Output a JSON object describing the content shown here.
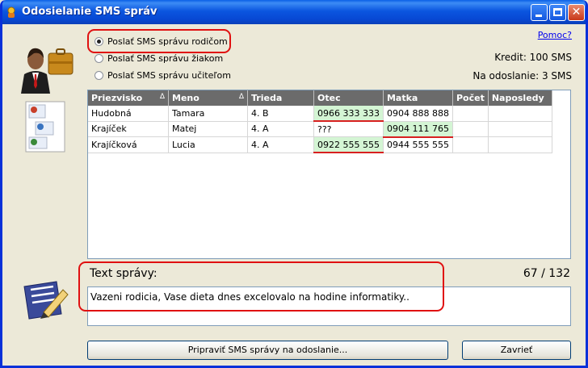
{
  "window": {
    "title": "Odosielanie SMS správ"
  },
  "options": {
    "parents": "Poslať SMS správu rodičom",
    "students": "Poslať SMS správu žiakom",
    "teachers": "Poslať SMS správu učiteľom",
    "selected": "parents"
  },
  "help_link": "Pomoc?",
  "credit": "Kredit: 100 SMS",
  "to_send": "Na odoslanie: 3 SMS",
  "table": {
    "columns": [
      "Priezvisko",
      "Meno",
      "Trieda",
      "Otec",
      "Matka",
      "Počet",
      "Naposledy"
    ],
    "sortable": [
      true,
      true,
      false,
      false,
      false,
      false,
      false
    ],
    "rows": [
      [
        "Hudobná",
        "Tamara",
        "4. B",
        "0966 333 333",
        "0904 888 888",
        "",
        ""
      ],
      [
        "Krajíček",
        "Matej",
        "4. A",
        "???",
        "0904 111 765",
        "",
        ""
      ],
      [
        "Krajíčková",
        "Lucia",
        "4. A",
        "0922 555 555",
        "0944 555 555",
        "",
        ""
      ]
    ]
  },
  "message": {
    "label": "Text správy:",
    "counter": "67 / 132",
    "text": "Vazeni rodicia, Vase dieta dnes excelovalo na hodine informatiky.."
  },
  "buttons": {
    "prepare": "Pripraviť SMS správy na odoslanie...",
    "close": "Zavrieť"
  },
  "colors": {
    "titlebar": "#0b56e0",
    "highlight": "#e01010",
    "phone_ok": "#d4f5d4"
  },
  "icons": [
    "app-icon",
    "businessman-icon",
    "contact-cards-icon",
    "edit-note-icon",
    "minimize-icon",
    "maximize-icon",
    "close-icon"
  ]
}
